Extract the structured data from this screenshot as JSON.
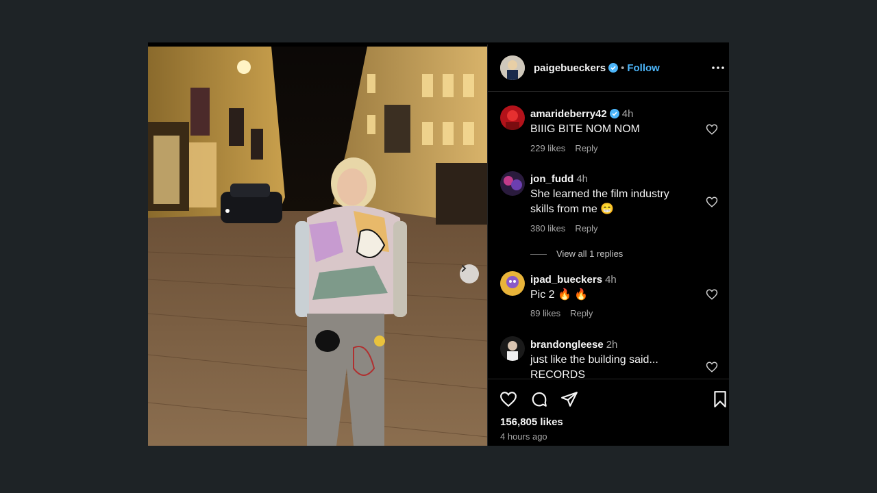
{
  "post": {
    "author": "paigebueckers",
    "follow_label": "Follow",
    "separator": "•",
    "likes": "156,805 likes",
    "time_ago": "4 hours ago"
  },
  "comments": [
    {
      "user": "amarideberry42",
      "verified": true,
      "time": "4h",
      "text": "BIIIG BITE NOM NOM",
      "likes": "229 likes",
      "reply": "Reply"
    },
    {
      "user": "jon_fudd",
      "verified": false,
      "time": "4h",
      "text": "She learned the film industry skills from me 😁",
      "likes": "380 likes",
      "reply": "Reply",
      "view_replies": "View all 1 replies"
    },
    {
      "user": "ipad_bueckers",
      "verified": false,
      "time": "4h",
      "text": "Pic 2 🔥 🔥",
      "likes": "89 likes",
      "reply": "Reply"
    },
    {
      "user": "brandongleese",
      "verified": false,
      "time": "2h",
      "text": "just like the building said... RECORDS"
    }
  ],
  "icons": {
    "verified": "verified-badge-icon",
    "more": "more-options-icon",
    "like": "heart-icon",
    "comment": "comment-icon",
    "share": "share-icon",
    "save": "bookmark-icon",
    "next": "chevron-right-icon"
  },
  "colors": {
    "background": "#1e2326",
    "panel": "#000000",
    "accent": "#4cb5f9",
    "muted": "#a8a8a8"
  }
}
